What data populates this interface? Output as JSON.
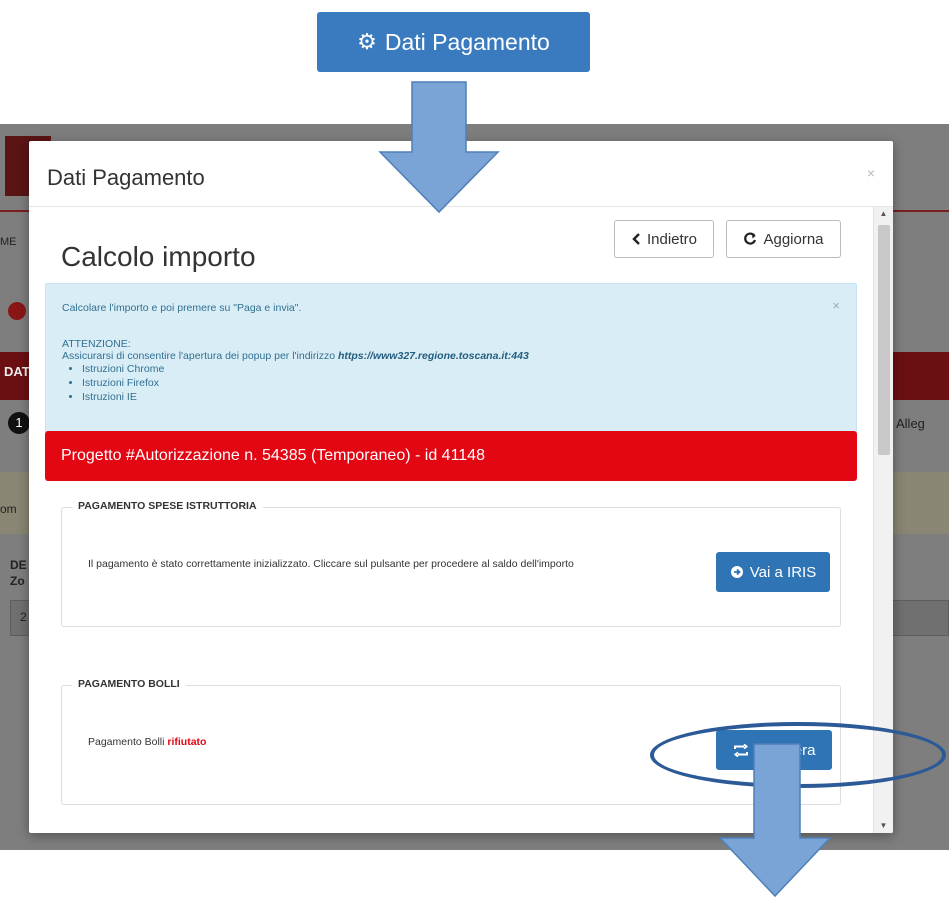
{
  "top_button": {
    "label": "Dati Pagamento",
    "icon": "gears-icon"
  },
  "background_page": {
    "fragments": [
      "ME",
      "DAT",
      "Alleg",
      "om",
      "DE",
      "Zo",
      "2"
    ],
    "step_number": "1"
  },
  "modal": {
    "title": "Dati Pagamento",
    "close": "×",
    "page_title": "Calcolo importo",
    "back_label": "Indietro",
    "refresh_label": "Aggiorna",
    "alert": {
      "close": "×",
      "line1": "Calcolare l'importo e poi premere su \"Paga e invia\".",
      "attention": "ATTENZIONE:",
      "line2": "Assicurarsi di consentire l'apertura dei popup per l'indirizzo",
      "url": "https://www327.regione.toscana.it:443",
      "items": [
        "Istruzioni Chrome",
        "Istruzioni Firefox",
        "Istruzioni IE"
      ]
    },
    "project_title": "Progetto #Autorizzazione n. 54385 (Temporaneo) - id 41148",
    "panel_istruttoria": {
      "legend": "PAGAMENTO SPESE ISTRUTTORIA",
      "text": "Il pagamento è stato correttamente inizializzato. Cliccare sul pulsante per procedere al saldo dell'importo",
      "button_label": "Vai a IRIS"
    },
    "panel_bolli": {
      "legend": "PAGAMENTO BOLLI",
      "text_prefix": "Pagamento Bolli",
      "status": "rifiutato",
      "button_label": "Rigenera"
    }
  },
  "colors": {
    "primary": "#2f75b5",
    "top_button": "#3a7abf",
    "project_bar": "#e30613",
    "alert_bg": "#d9edf7",
    "annotation": "#7aa3d6",
    "ellipse": "#2b5a96"
  }
}
